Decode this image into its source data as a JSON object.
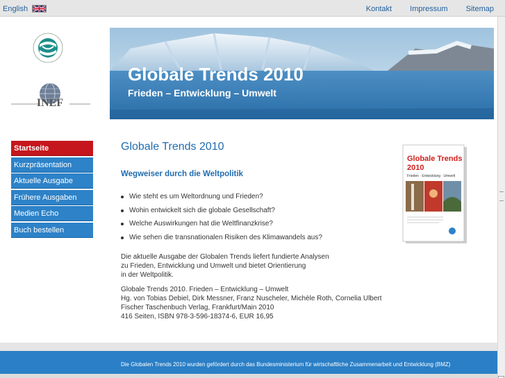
{
  "topbar": {
    "language_link": "English",
    "links": [
      "Kontakt",
      "Impressum",
      "Sitemap"
    ]
  },
  "banner": {
    "title": "Globale Trends 2010",
    "subtitle": "Frieden – Entwicklung – Umwelt"
  },
  "logos": {
    "inef_text": "INEF"
  },
  "nav": {
    "items": [
      {
        "label": "Startseite",
        "active": true
      },
      {
        "label": "Kurzpräsentation",
        "active": false
      },
      {
        "label": "Aktuelle Ausgabe",
        "active": false
      },
      {
        "label": "Frühere Ausgaben",
        "active": false
      },
      {
        "label": "Medien Echo",
        "active": false
      },
      {
        "label": "Buch bestellen",
        "active": false
      }
    ]
  },
  "content": {
    "heading": "Globale Trends 2010",
    "subheading": "Wegweiser durch die Weltpolitik",
    "questions": [
      "Wie steht es um Weltordnung und Frieden?",
      "Wohin entwickelt sich die globale Gesellschaft?",
      "Welche Auswirkungen hat die Weltfinanzkrise?",
      "Wie sehen die transnationalen Risiken des Klimawandels aus?"
    ],
    "intro_lines": [
      "Die aktuelle Ausgabe der Globalen Trends liefert fundierte Analysen",
      "zu Frieden, Entwicklung und Umwelt und bietet Orientierung",
      "in der Weltpolitik."
    ],
    "bib_lines": [
      "Globale Trends 2010. Frieden – Entwicklung – Umwelt",
      "Hg. von Tobias Debiel, Dirk Messner, Franz Nuscheler, Michèle Roth, Cornelia Ulbert",
      "Fischer Taschenbuch Verlag, Frankfurt/Main 2010",
      "416 Seiten, ISBN 978-3-596-18374-6, EUR 16,95"
    ]
  },
  "book": {
    "title_line1": "Globale Trends",
    "title_line2": "2010",
    "subtitle": "Frieden · Entwicklung · Umwelt"
  },
  "footer": {
    "text": "Die Globalen Trends 2010 wurden gefördert durch das Bundesministerium für wirtschaftliche Zusammenarbeit und Entwicklung (BMZ)"
  },
  "colors": {
    "accent_blue": "#2d82c8",
    "active_red": "#c5161d",
    "heading_blue": "#1f6cb0"
  }
}
